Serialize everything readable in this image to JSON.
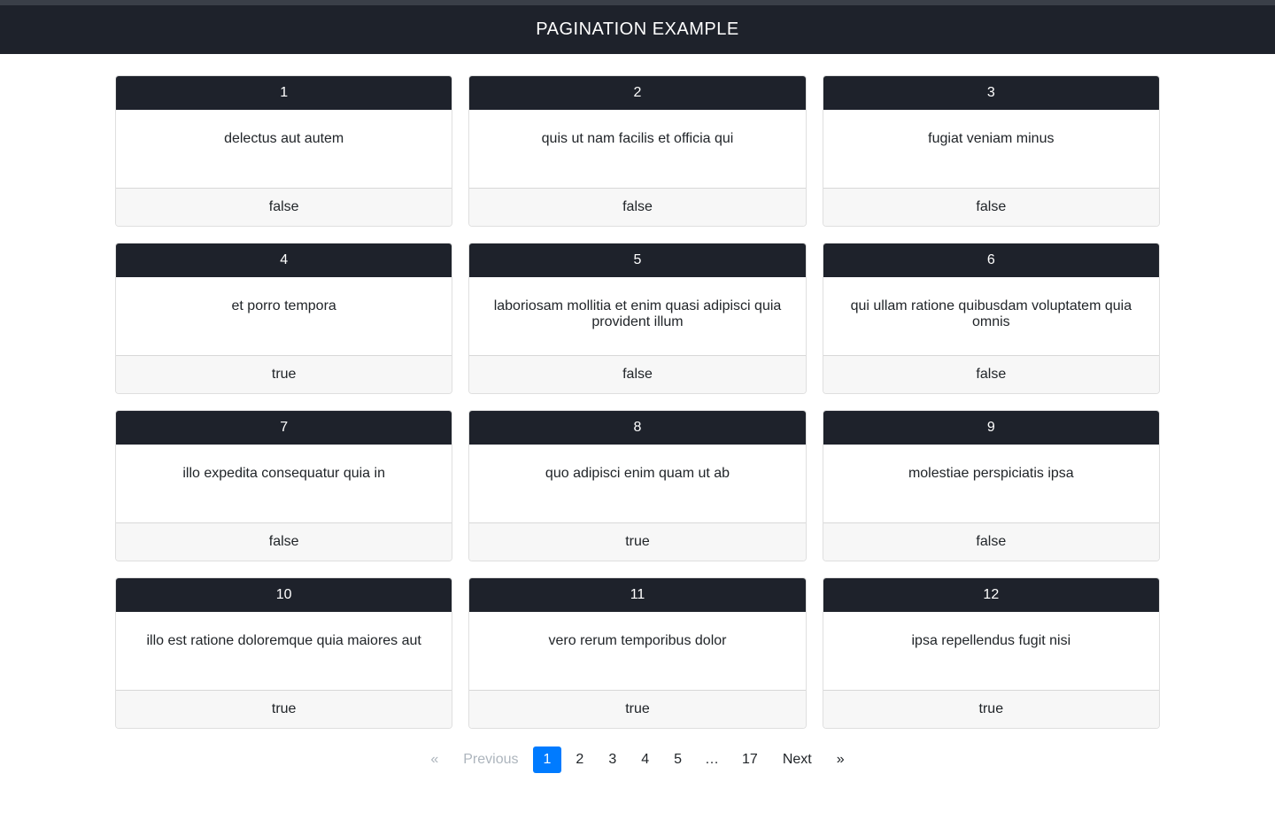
{
  "header": {
    "title": "PAGINATION EXAMPLE"
  },
  "cards": [
    {
      "id": "1",
      "title": "delectus aut autem",
      "footer": "false"
    },
    {
      "id": "2",
      "title": "quis ut nam facilis et officia qui",
      "footer": "false"
    },
    {
      "id": "3",
      "title": "fugiat veniam minus",
      "footer": "false"
    },
    {
      "id": "4",
      "title": "et porro tempora",
      "footer": "true"
    },
    {
      "id": "5",
      "title": "laboriosam mollitia et enim quasi adipisci quia provident illum",
      "footer": "false"
    },
    {
      "id": "6",
      "title": "qui ullam ratione quibusdam voluptatem quia omnis",
      "footer": "false"
    },
    {
      "id": "7",
      "title": "illo expedita consequatur quia in",
      "footer": "false"
    },
    {
      "id": "8",
      "title": "quo adipisci enim quam ut ab",
      "footer": "true"
    },
    {
      "id": "9",
      "title": "molestiae perspiciatis ipsa",
      "footer": "false"
    },
    {
      "id": "10",
      "title": "illo est ratione doloremque quia maiores aut",
      "footer": "true"
    },
    {
      "id": "11",
      "title": "vero rerum temporibus dolor",
      "footer": "true"
    },
    {
      "id": "12",
      "title": "ipsa repellendus fugit nisi",
      "footer": "true"
    }
  ],
  "pagination": {
    "prev_arrow": "«",
    "prev_label": "Previous",
    "next_label": "Next",
    "next_arrow": "»",
    "ellipsis": "…",
    "pages_left": [
      "1",
      "2",
      "3",
      "4",
      "5"
    ],
    "pages_right": [
      "17"
    ],
    "active_page": "1"
  }
}
